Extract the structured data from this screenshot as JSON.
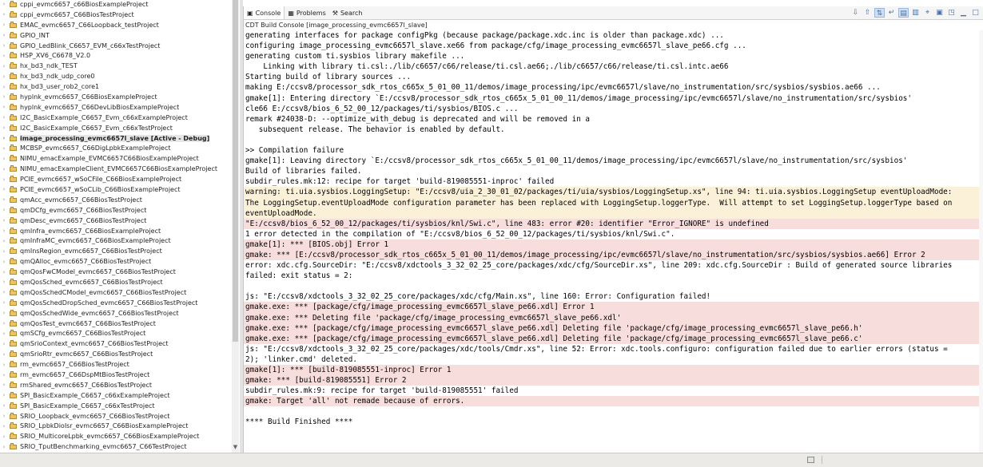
{
  "explorer": {
    "projects": [
      {
        "label": "cppi_evmc6657_c66BiosExampleProject"
      },
      {
        "label": "cppi_evmc6657_C66BiosTestProject"
      },
      {
        "label": "EMAC_evmc6657_C66Loopback_testProject"
      },
      {
        "label": "GPIO_INT"
      },
      {
        "label": "GPIO_LedBlink_C6657_EVM_c66xTestProject"
      },
      {
        "label": "HSP_XV6_C6678_V2.0"
      },
      {
        "label": "hx_bd3_ndk_TEST"
      },
      {
        "label": "hx_bd3_ndk_udp_core0"
      },
      {
        "label": "hx_bd3_user_rob2_core1"
      },
      {
        "label": "hyplnk_evmc6657_C66BiosExampleProject"
      },
      {
        "label": "hyplnk_evmc6657_C66DevLibBiosExampleProject"
      },
      {
        "label": "I2C_BasicExample_C6657_Evm_c66xExampleProject"
      },
      {
        "label": "I2C_BasicExample_C6657_Evm_c66xTestProject"
      },
      {
        "label": "image_processing_evmc6657l_slave  [Active - Debug]",
        "active": true
      },
      {
        "label": "MCBSP_evmc6657_C66DigLpbkExampleProject"
      },
      {
        "label": "NIMU_emacExample_EVMC6657C66BiosExampleProject"
      },
      {
        "label": "NIMU_emacExampleClient_EVMC6657C66BiosExampleProject"
      },
      {
        "label": "PCIE_evmc6657_wSoCFile_C66BiosExampleProject"
      },
      {
        "label": "PCIE_evmc6657_wSoCLib_C66BiosExampleProject"
      },
      {
        "label": "qmAcc_evmc6657_C66BiosTestProject"
      },
      {
        "label": "qmDCfg_evmc6657_C66BiosTestProject"
      },
      {
        "label": "qmDesc_evmc6657_C66BiosTestProject"
      },
      {
        "label": "qmInfra_evmc6657_C66BiosExampleProject"
      },
      {
        "label": "qmInfraMC_evmc6657_C66BiosExampleProject"
      },
      {
        "label": "qmInsRegion_evmc6657_C66BiosTestProject"
      },
      {
        "label": "qmQAlloc_evmc6657_C66BiosTestProject"
      },
      {
        "label": "qmQosFwCModel_evmc6657_C66BiosTestProject"
      },
      {
        "label": "qmQosSched_evmc6657_C66BiosTestProject"
      },
      {
        "label": "qmQosSchedCModel_evmc6657_C66BiosTestProject"
      },
      {
        "label": "qmQosSchedDropSched_evmc6657_C66BiosTestProject"
      },
      {
        "label": "qmQosSchedWide_evmc6657_C66BiosTestProject"
      },
      {
        "label": "qmQosTest_evmc6657_C66BiosTestProject"
      },
      {
        "label": "qmSCfg_evmc6657_C66BiosTestProject"
      },
      {
        "label": "qmSrioContext_evmc6657_C66BiosTestProject"
      },
      {
        "label": "qmSrioRtr_evmc6657_C66BiosTestProject"
      },
      {
        "label": "rm_evmc6657_C66BiosTestProject"
      },
      {
        "label": "rm_evmc6657_C66DspMtBiosTestProject"
      },
      {
        "label": "rmShared_evmc6657_C66BiosTestProject"
      },
      {
        "label": "SPI_BasicExample_C6657_c66xExampleProject"
      },
      {
        "label": "SPI_BasicExample_C6657_c66xTestProject"
      },
      {
        "label": "SRIO_Loopback_evmc6657_C66BiosTestProject"
      },
      {
        "label": "SRIO_LpbkDioIsr_evmc6657_C66BiosExampleProject"
      },
      {
        "label": "SRIO_MulticoreLpbk_evmc6657_C66BiosExampleProject"
      },
      {
        "label": "SRIO_TputBenchmarking_evmc6657_C66TestProject"
      }
    ]
  },
  "console": {
    "tabs": [
      {
        "label": "Console",
        "icon": "console-icon",
        "selected": true
      },
      {
        "label": "Problems",
        "icon": "problems-icon"
      },
      {
        "label": "Search",
        "icon": "search-icon"
      }
    ],
    "toolbar_icons": [
      "scroll-down-icon",
      "scroll-up-icon",
      "scroll-lock-icon",
      "word-wrap-icon",
      "show-on-output-icon",
      "show-on-error-icon",
      "pin-console-icon",
      "display-console-icon",
      "open-console-icon",
      "minimize-icon",
      "maximize-icon"
    ],
    "title": "CDT Build Console [image_processing_evmc6657l_slave]",
    "lines": [
      {
        "text": "generating interfaces for package configPkg (because package/package.xdc.inc is older than package.xdc) ...",
        "kind": "normal"
      },
      {
        "text": "configuring image_processing_evmc6657l_slave.xe66 from package/cfg/image_processing_evmc6657l_slave_pe66.cfg ...",
        "kind": "normal"
      },
      {
        "text": "generating custom ti.sysbios library makefile ...",
        "kind": "normal"
      },
      {
        "text": "    Linking with library ti.csl:./lib/c6657/c66/release/ti.csl.ae66;./lib/c6657/c66/release/ti.csl.intc.ae66",
        "kind": "normal"
      },
      {
        "text": "Starting build of library sources ...",
        "kind": "normal"
      },
      {
        "text": "making E:/ccsv8/processor_sdk_rtos_c665x_5_01_00_11/demos/image_processing/ipc/evmc6657l/slave/no_instrumentation/src/sysbios/sysbios.ae66 ...",
        "kind": "normal"
      },
      {
        "text": "gmake[1]: Entering directory `E:/ccsv8/processor_sdk_rtos_c665x_5_01_00_11/demos/image_processing/ipc/evmc6657l/slave/no_instrumentation/src/sysbios'",
        "kind": "normal"
      },
      {
        "text": "cle66 E:/ccsv8/bios_6_52_00_12/packages/ti/sysbios/BIOS.c ...",
        "kind": "normal"
      },
      {
        "text": "remark #24038-D: --optimize_with_debug is deprecated and will be removed in a",
        "kind": "normal"
      },
      {
        "text": "   subsequent release. The behavior is enabled by default.",
        "kind": "normal"
      },
      {
        "text": "",
        "kind": "normal"
      },
      {
        "text": ">> Compilation failure",
        "kind": "normal"
      },
      {
        "text": "gmake[1]: Leaving directory `E:/ccsv8/processor_sdk_rtos_c665x_5_01_00_11/demos/image_processing/ipc/evmc6657l/slave/no_instrumentation/src/sysbios'",
        "kind": "normal"
      },
      {
        "text": "Build of libraries failed.",
        "kind": "normal"
      },
      {
        "text": "subdir_rules.mk:12: recipe for target 'build-819085551-inproc' failed",
        "kind": "normal"
      },
      {
        "text": "warning: ti.uia.sysbios.LoggingSetup: \"E:/ccsv8/uia_2_30_01_02/packages/ti/uia/sysbios/LoggingSetup.xs\", line 94: ti.uia.sysbios.LoggingSetup eventUploadMode:",
        "kind": "warn"
      },
      {
        "text": "The LoggingSetup.eventUploadMode configuration parameter has been replaced with LoggingSetup.loggerType.  Will attempt to set LoggingSetup.loggerType based on",
        "kind": "warn"
      },
      {
        "text": "eventUploadMode.",
        "kind": "warn"
      },
      {
        "text": "\"E:/ccsv8/bios_6_52_00_12/packages/ti/sysbios/knl/Swi.c\", line 483: error #20: identifier \"Error_IGNORE\" is undefined",
        "kind": "err"
      },
      {
        "text": "1 error detected in the compilation of \"E:/ccsv8/bios_6_52_00_12/packages/ti/sysbios/knl/Swi.c\".",
        "kind": "normal"
      },
      {
        "text": "gmake[1]: *** [BIOS.obj] Error 1",
        "kind": "err"
      },
      {
        "text": "gmake: *** [E:/ccsv8/processor_sdk_rtos_c665x_5_01_00_11/demos/image_processing/ipc/evmc6657l/slave/no_instrumentation/src/sysbios/sysbios.ae66] Error 2",
        "kind": "err"
      },
      {
        "text": "error: xdc.cfg.SourceDir: \"E:/ccsv8/xdctools_3_32_02_25_core/packages/xdc/cfg/SourceDir.xs\", line 209: xdc.cfg.SourceDir : Build of generated source libraries",
        "kind": "normal"
      },
      {
        "text": "failed: exit status = 2:",
        "kind": "normal"
      },
      {
        "text": "",
        "kind": "normal"
      },
      {
        "text": "js: \"E:/ccsv8/xdctools_3_32_02_25_core/packages/xdc/cfg/Main.xs\", line 160: Error: Configuration failed!",
        "kind": "normal"
      },
      {
        "text": "gmake.exe: *** [package/cfg/image_processing_evmc6657l_slave_pe66.xdl] Error 1",
        "kind": "err"
      },
      {
        "text": "gmake.exe: *** Deleting file 'package/cfg/image_processing_evmc6657l_slave_pe66.xdl'",
        "kind": "err"
      },
      {
        "text": "gmake.exe: *** [package/cfg/image_processing_evmc6657l_slave_pe66.xdl] Deleting file 'package/cfg/image_processing_evmc6657l_slave_pe66.h'",
        "kind": "err"
      },
      {
        "text": "gmake.exe: *** [package/cfg/image_processing_evmc6657l_slave_pe66.xdl] Deleting file 'package/cfg/image_processing_evmc6657l_slave_pe66.c'",
        "kind": "err"
      },
      {
        "text": "js: \"E:/ccsv8/xdctools_3_32_02_25_core/packages/xdc/tools/Cmdr.xs\", line 52: Error: xdc.tools.configuro: configuration failed due to earlier errors (status =",
        "kind": "normal"
      },
      {
        "text": "2); 'linker.cmd' deleted.",
        "kind": "normal"
      },
      {
        "text": "gmake[1]: *** [build-819085551-inproc] Error 1",
        "kind": "err"
      },
      {
        "text": "gmake: *** [build-819085551] Error 2",
        "kind": "err"
      },
      {
        "text": "subdir_rules.mk:9: recipe for target 'build-819085551' failed",
        "kind": "normal"
      },
      {
        "text": "gmake: Target 'all' not remade because of errors.",
        "kind": "err"
      },
      {
        "text": "",
        "kind": "normal"
      },
      {
        "text": "**** Build Finished ****",
        "kind": "normal"
      }
    ]
  },
  "colors": {
    "error_bg": "#f7dedd",
    "warning_bg": "#fbf1d9",
    "folder": "#e8c46a"
  }
}
